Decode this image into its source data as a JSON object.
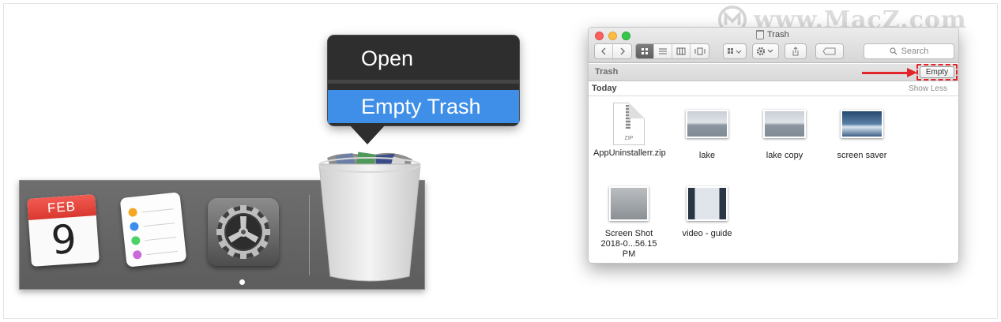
{
  "watermark": {
    "text": "www.MacZ.com"
  },
  "dock": {
    "calendar": {
      "month": "FEB",
      "day": "9"
    },
    "reminders_colors": [
      "#f5a623",
      "#3d8cf0",
      "#4cd264",
      "#c86ad9"
    ]
  },
  "context_menu": {
    "items": [
      {
        "label": "Open"
      },
      {
        "label": "Empty Trash",
        "highlighted": true
      }
    ]
  },
  "finder": {
    "title": "Trash",
    "search_placeholder": "Search",
    "path_label": "Trash",
    "empty_button": "Empty",
    "section_title": "Today",
    "show_less": "Show Less",
    "files": [
      {
        "name": "AppUninstallerr.zip",
        "kind": "zip",
        "icon_label": "ZIP"
      },
      {
        "name": "lake",
        "kind": "image",
        "colors": [
          "#c9cfd6",
          "#7f8b97"
        ]
      },
      {
        "name": "lake copy",
        "kind": "image",
        "colors": [
          "#c9cfd6",
          "#7f8b97"
        ]
      },
      {
        "name": "screen saver",
        "kind": "image",
        "colors": [
          "#27496e",
          "#d9e6f0"
        ]
      },
      {
        "name": "Screen Shot 2018-0...56.15 PM",
        "kind": "image",
        "colors": [
          "#b9bdc0",
          "#8b9094"
        ]
      },
      {
        "name": "video - guide",
        "kind": "image",
        "colors": [
          "#2a3645",
          "#dfe5ea"
        ]
      }
    ]
  },
  "colors": {
    "accent": "#3f8ee7",
    "annotation_red": "#e3242b",
    "traffic_red": "#fc605c",
    "traffic_yellow": "#fdbc40",
    "traffic_green": "#34c84a"
  }
}
